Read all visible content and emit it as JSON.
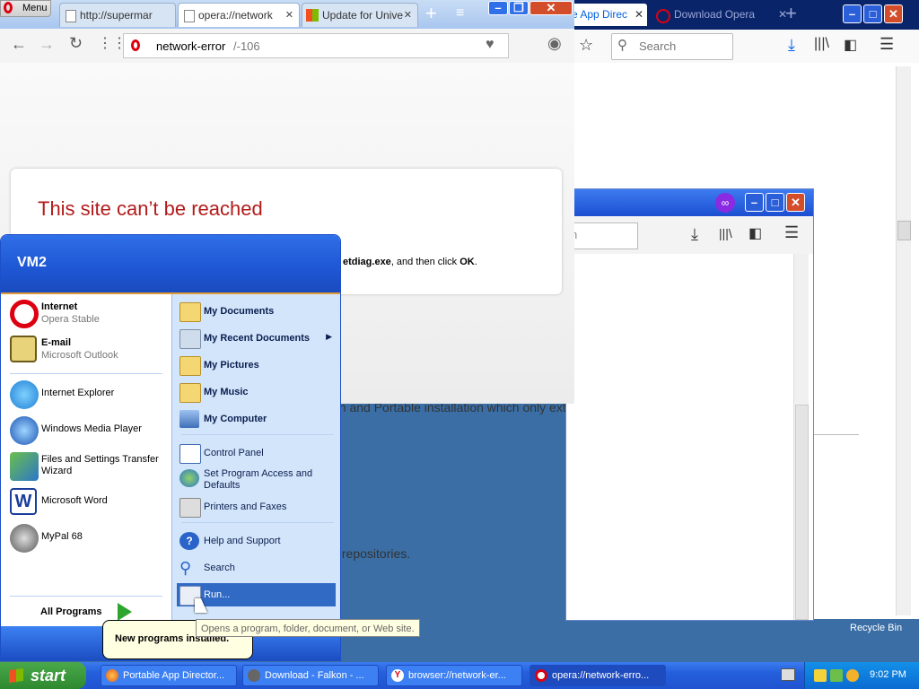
{
  "firefox": {
    "tab_active": "e App Direc",
    "tab_inactive": "Download Opera",
    "search_placeholder": "Search",
    "colors": {
      "titlebar": "#0a246a",
      "accent": "#0060df"
    }
  },
  "falkon": {
    "url_partial": "n"
  },
  "background_page": {
    "text_line1": "on and Portable installation which only extracts files and setup the",
    "text_line2": "s repositories."
  },
  "opera": {
    "menu_label": "Menu",
    "tabs": [
      {
        "label": "http://supermar"
      },
      {
        "label": "opera://network"
      },
      {
        "label": "Update for Unive"
      }
    ],
    "address": {
      "host": "network-error",
      "path": "/-106"
    },
    "error_title": "This site can’t be reached",
    "error_hint_prefix": "etdiag.exe",
    "error_hint_mid": ", and then click ",
    "error_hint_ok": "OK",
    "error_hint_suffix": ".",
    "colors": {
      "error_title": "#b31b1b"
    }
  },
  "start_menu": {
    "user": "VM2",
    "pinned": [
      {
        "title": "Internet",
        "subtitle": "Opera Stable",
        "icon": "opera-icon"
      },
      {
        "title": "E-mail",
        "subtitle": "Microsoft Outlook",
        "icon": "outlook-icon"
      }
    ],
    "recent": [
      {
        "title": "Internet Explorer",
        "icon": "internet-explorer-icon"
      },
      {
        "title": "Windows Media Player",
        "icon": "media-player-icon"
      },
      {
        "title": "Files and Settings Transfer",
        "title2": "Wizard",
        "icon": "transfer-wizard-icon"
      },
      {
        "title": "Microsoft Word",
        "icon": "word-icon"
      },
      {
        "title": "MyPal 68",
        "icon": "mypal-icon"
      }
    ],
    "all_programs": "All Programs",
    "places": [
      {
        "label": "My Documents",
        "icon": "folder-icon"
      },
      {
        "label": "My Recent Documents",
        "icon": "recent-docs-icon"
      },
      {
        "label": "My Pictures",
        "icon": "pictures-folder-icon"
      },
      {
        "label": "My Music",
        "icon": "music-folder-icon"
      },
      {
        "label": "My Computer",
        "icon": "computer-icon"
      }
    ],
    "settings": [
      {
        "label": "Control Panel",
        "icon": "control-panel-icon"
      },
      {
        "label": "Set Program Access and",
        "label2": "Defaults",
        "icon": "program-access-icon"
      },
      {
        "label": "Printers and Faxes",
        "icon": "printer-icon"
      }
    ],
    "help": [
      {
        "label": "Help and Support",
        "icon": "help-icon"
      },
      {
        "label": "Search",
        "icon": "search-icon"
      },
      {
        "label": "Run...",
        "icon": "run-icon"
      }
    ]
  },
  "tooltip": "Opens a program, folder, document, or Web site.",
  "balloon": "New programs installed.",
  "desktop": {
    "recycle_bin": "Recycle Bin"
  },
  "taskbar": {
    "start_label": "start",
    "buttons": [
      {
        "label": "Portable App Director...",
        "icon": "firefox-icon"
      },
      {
        "label": "Download - Falkon - ...",
        "icon": "falkon-icon"
      },
      {
        "label": "browser://network-er...",
        "icon": "yandex-icon"
      },
      {
        "label": "opera://network-erro...",
        "icon": "opera-icon"
      }
    ],
    "clock": "9:02 PM"
  }
}
